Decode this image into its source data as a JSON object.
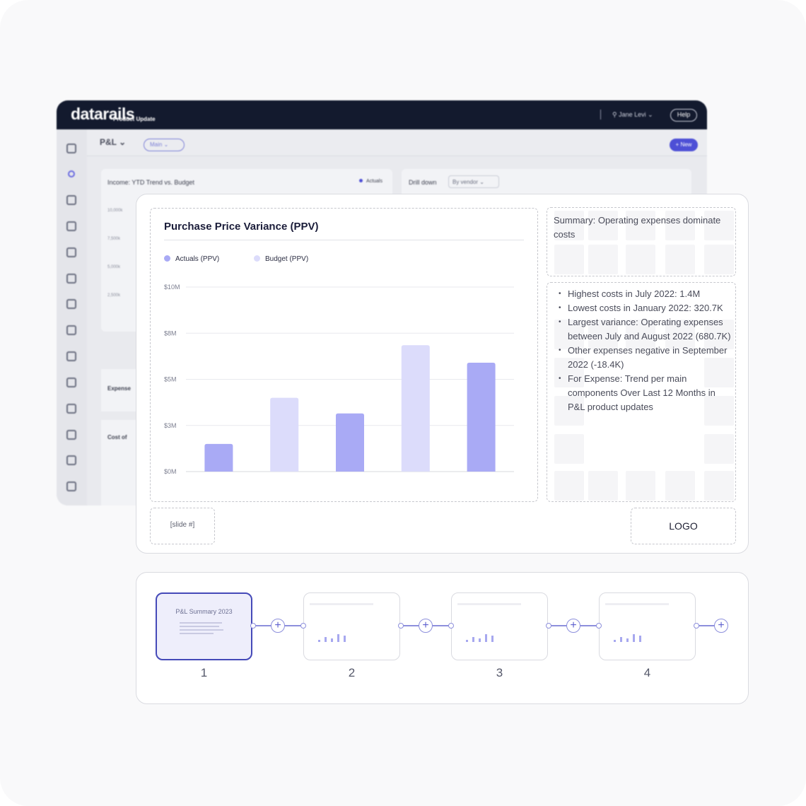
{
  "app": {
    "brand": "datarails",
    "brand_sub": "Product Update",
    "user": "Jane Levi",
    "help": "Help",
    "report": "P&L",
    "view": "Main",
    "new_button": "+ New",
    "card1_title": "Income: YTD Trend vs. Budget",
    "card1_legend": "Actuals",
    "card1_ticks": [
      "10,000k",
      "7,500k",
      "5,000k",
      "2,500k"
    ],
    "card2_title": "Drill down",
    "card2_select": "By vendor",
    "card4_label": "Expense",
    "card5_label": "Cost of"
  },
  "slide": {
    "summary": "Summary: Operating expenses dominate costs",
    "bullets": [
      "Highest costs in July 2022: 1.4M",
      " Lowest costs in January 2022: 320.7K",
      " Largest variance: Operating expenses between July and August 2022 (680.7K)",
      "Other expenses negative in September 2022 (-18.4K)",
      "For Expense: Trend per main components Over Last 12 Months in P&L product updates"
    ],
    "slide_number": "[slide #]",
    "logo": "LOGO"
  },
  "chart_data": {
    "type": "bar",
    "title": "Purchase Price Variance (PPV)",
    "series": [
      {
        "name": "Actuals (PPV)",
        "color": "#a9aaf5"
      },
      {
        "name": "Budget (PPV)",
        "color": "#dcdcfb"
      }
    ],
    "bars": [
      {
        "series": "Actuals (PPV)",
        "value": 1.5
      },
      {
        "series": "Budget (PPV)",
        "value": 4.0
      },
      {
        "series": "Actuals (PPV)",
        "value": 3.15
      },
      {
        "series": "Budget (PPV)",
        "value": 6.85
      },
      {
        "series": "Actuals (PPV)",
        "value": 5.9
      }
    ],
    "y_ticks": [
      {
        "value": 0,
        "label": "$0M"
      },
      {
        "value": 2.5,
        "label": "$3M"
      },
      {
        "value": 5,
        "label": "$5M"
      },
      {
        "value": 7.5,
        "label": "$8M"
      },
      {
        "value": 10,
        "label": "$10M"
      }
    ],
    "ylim": [
      0,
      10
    ],
    "grid": true,
    "legend_position": "top-left"
  },
  "strip": {
    "first_title": "P&L Summary 2023",
    "slides": [
      "1",
      "2",
      "3",
      "4"
    ],
    "add_symbol": "+"
  }
}
